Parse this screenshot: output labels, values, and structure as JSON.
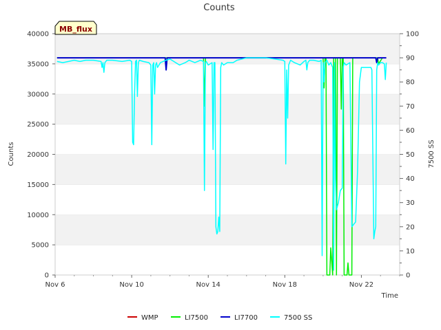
{
  "chart_data": {
    "type": "line",
    "title": "Counts",
    "badge": "MB_flux",
    "xlabel": "Time",
    "ylabel": "Counts",
    "y2label": "7500 SS",
    "x_ticks": [
      {
        "label": "Nov 6",
        "day": 6
      },
      {
        "label": "Nov 10",
        "day": 10
      },
      {
        "label": "Nov 14",
        "day": 14
      },
      {
        "label": "Nov 18",
        "day": 18
      },
      {
        "label": "Nov 22",
        "day": 22
      }
    ],
    "xlim": [
      6,
      24
    ],
    "ylim": [
      0,
      40000
    ],
    "y_ticks": [
      0,
      5000,
      10000,
      15000,
      20000,
      25000,
      30000,
      35000,
      40000
    ],
    "y2lim": [
      0,
      100
    ],
    "y2_ticks": [
      0,
      10,
      20,
      30,
      40,
      50,
      60,
      70,
      80,
      90,
      100
    ],
    "grid": "horizontal bands",
    "legend_position": "bottom",
    "legend": [
      {
        "name": "WMP",
        "color": "#cc0000"
      },
      {
        "name": "LI7500",
        "color": "#00ee00"
      },
      {
        "name": "LI7700",
        "color": "#0000cc"
      },
      {
        "name": "7500 SS",
        "color": "#00ffff"
      }
    ],
    "series": [
      {
        "name": "LI7500",
        "axis": "left",
        "color": "#00ee00",
        "x": [
          6.1,
          13.75,
          13.8,
          13.85,
          13.9,
          20.0,
          20.05,
          20.1,
          20.15,
          20.2,
          20.35,
          20.4,
          20.5,
          20.55,
          20.6,
          20.65,
          20.7,
          20.75,
          20.9,
          20.95,
          21.0,
          21.05,
          21.1,
          21.2,
          21.25,
          21.3,
          21.35,
          21.45,
          21.5,
          21.55,
          21.6,
          21.65,
          21.7,
          21.75,
          22.85,
          22.9,
          23.1
        ],
        "y": [
          36000,
          36000,
          28000,
          36000,
          36000,
          36000,
          31000,
          36000,
          36000,
          0,
          0,
          4500,
          0,
          36000,
          36000,
          36000,
          0,
          36000,
          36000,
          27500,
          36000,
          36000,
          0,
          0,
          0,
          2000,
          0,
          0,
          0,
          36000,
          36000,
          36000,
          36000,
          36000,
          36000,
          35000,
          36000
        ]
      },
      {
        "name": "LI7700",
        "axis": "left",
        "color": "#0000cc",
        "x": [
          6.1,
          11.75,
          11.8,
          11.85,
          11.9,
          22.75,
          22.8,
          22.85,
          23.3
        ],
        "y": [
          36000,
          36000,
          34000,
          36000,
          36000,
          36000,
          35200,
          36000,
          36000
        ]
      },
      {
        "name": "7500 SS",
        "axis": "right",
        "color": "#00ffff",
        "x": [
          6.1,
          6.4,
          6.7,
          7.0,
          7.3,
          7.6,
          8.0,
          8.4,
          8.45,
          8.5,
          8.55,
          8.6,
          8.7,
          9.0,
          9.5,
          9.9,
          10.0,
          10.05,
          10.1,
          10.15,
          10.2,
          10.25,
          10.3,
          10.35,
          10.4,
          10.6,
          10.9,
          11.0,
          11.05,
          11.1,
          11.15,
          11.2,
          11.25,
          11.3,
          11.35,
          11.5,
          11.8,
          12.0,
          12.5,
          12.8,
          13.0,
          13.3,
          13.6,
          13.75,
          13.8,
          13.85,
          13.9,
          14.0,
          14.2,
          14.25,
          14.3,
          14.35,
          14.4,
          14.45,
          14.5,
          14.55,
          14.6,
          14.65,
          14.7,
          14.8,
          15.0,
          15.3,
          15.5,
          16.0,
          16.5,
          17.0,
          17.5,
          17.9,
          18.0,
          18.05,
          18.1,
          18.15,
          18.2,
          18.25,
          18.3,
          18.5,
          18.8,
          19.0,
          19.1,
          19.15,
          19.2,
          19.3,
          19.5,
          19.8,
          19.9,
          19.95,
          20.0,
          20.05,
          20.1,
          20.2,
          20.3,
          20.4,
          20.5,
          20.55,
          20.6,
          20.65,
          20.7,
          20.8,
          20.9,
          21.0,
          21.05,
          21.1,
          21.2,
          21.4,
          21.5,
          21.6,
          21.7,
          21.8,
          21.9,
          22.0,
          22.2,
          22.4,
          22.5,
          22.55,
          22.6,
          22.65,
          22.7,
          22.75,
          22.8,
          22.85,
          22.9,
          23.0,
          23.1,
          23.2,
          23.25,
          23.3
        ],
        "y": [
          88.5,
          88.0,
          88.5,
          89.0,
          88.5,
          89.0,
          89.0,
          88.5,
          86.0,
          88.0,
          84.0,
          88.0,
          89.0,
          89.0,
          88.5,
          89.0,
          88.5,
          55.0,
          54.0,
          75.0,
          88.5,
          89.0,
          74.0,
          88.0,
          89.0,
          88.5,
          88.0,
          87.0,
          54.0,
          87.0,
          88.0,
          75.0,
          87.0,
          88.0,
          86.0,
          88.0,
          89.0,
          89.5,
          87.0,
          88.0,
          89.0,
          88.0,
          89.0,
          88.5,
          35.0,
          88.0,
          88.5,
          87.0,
          88.0,
          52.0,
          88.0,
          88.0,
          20.0,
          17.0,
          18.0,
          24.0,
          18.0,
          86.0,
          88.0,
          87.0,
          88.0,
          88.0,
          89.0,
          90.0,
          90.0,
          90.0,
          89.5,
          89.0,
          88.5,
          46.0,
          85.0,
          65.0,
          87.0,
          88.0,
          89.0,
          88.0,
          87.0,
          88.5,
          89.0,
          85.0,
          88.0,
          89.0,
          89.0,
          88.5,
          89.0,
          8.0,
          88.0,
          80.0,
          88.0,
          89.0,
          87.0,
          88.0,
          86.0,
          2.0,
          88.0,
          40.0,
          27.0,
          30.0,
          35.0,
          36.0,
          86.0,
          88.0,
          87.0,
          88.0,
          20.0,
          21.0,
          22.0,
          43.0,
          80.0,
          86.0,
          86.0,
          86.0,
          86.0,
          85.0,
          50.0,
          15.0,
          18.0,
          20.0,
          85.0,
          88.0,
          87.0,
          88.0,
          88.0,
          87.5,
          81.0,
          88.0
        ]
      }
    ]
  }
}
